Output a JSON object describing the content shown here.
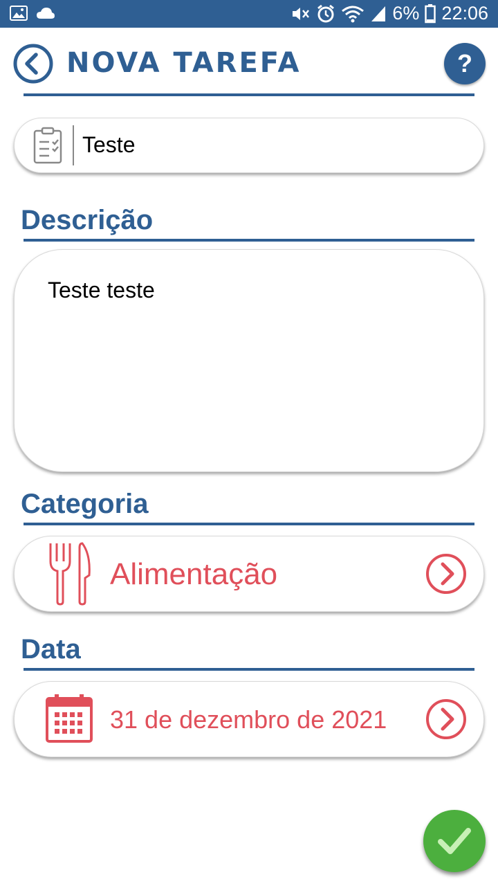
{
  "status_bar": {
    "battery": "6%",
    "time": "22:06",
    "icons": [
      "gallery-icon",
      "cloud-icon",
      "mute-icon",
      "alarm-icon",
      "wifi-icon",
      "signal-icon",
      "battery-icon"
    ]
  },
  "header": {
    "title": "NOVA TAREFA",
    "back_icon": "back-arrow-icon",
    "help_label": "?"
  },
  "task": {
    "title_value": "Teste",
    "icon": "clipboard-checklist-icon"
  },
  "description": {
    "label": "Descrição",
    "value": "Teste teste"
  },
  "category": {
    "label": "Categoria",
    "value": "Alimentação",
    "icon": "fork-knife-icon"
  },
  "date": {
    "label": "Data",
    "value": "31 de dezembro de 2021",
    "icon": "calendar-icon"
  },
  "confirm": {
    "icon": "checkmark-icon"
  },
  "colors": {
    "primary": "#2f5f93",
    "accent": "#e04f5a",
    "confirm": "#4caf3e"
  }
}
